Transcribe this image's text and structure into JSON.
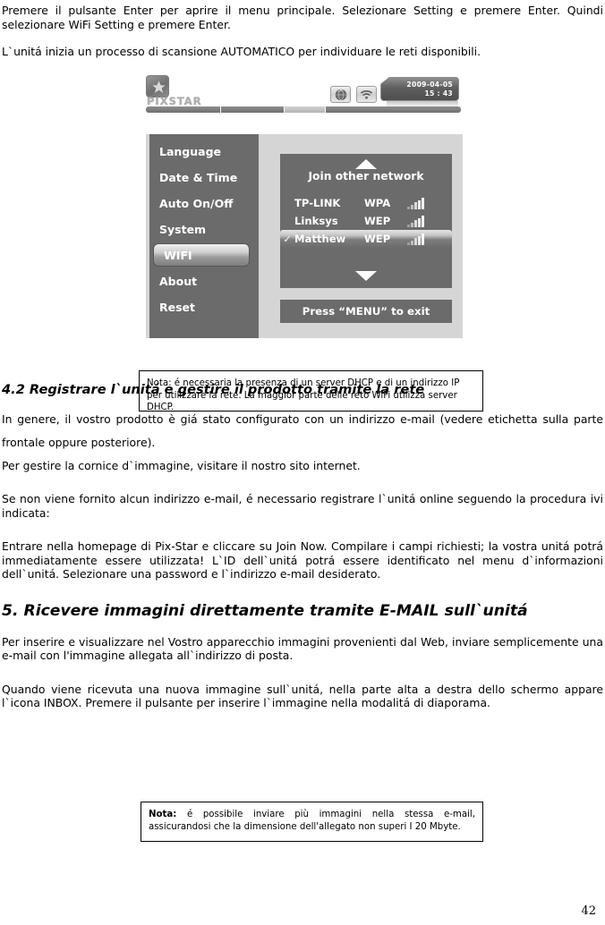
{
  "intro": {
    "p1": "Premere il pulsante Enter per aprire il menu principale. Selezionare Setting e premere Enter. Quindi selezionare WiFi Setting e premere Enter.",
    "p2": "L`unitá inizia un processo di scansione AUTOMATICO per individuare le reti disponibili."
  },
  "figure": {
    "logo_text": "PIXSTAR",
    "datetime": {
      "date": "2009-04-05",
      "time": "15 : 43"
    },
    "icons": {
      "globe": "globe-icon",
      "wifi": "wifi-icon"
    },
    "menu": {
      "items": [
        {
          "label": "Language",
          "selected": false
        },
        {
          "label": "Date & Time",
          "selected": false
        },
        {
          "label": "Auto On/Off",
          "selected": false
        },
        {
          "label": "System",
          "selected": false
        },
        {
          "label": "WIFI",
          "selected": true
        },
        {
          "label": "About",
          "selected": false
        },
        {
          "label": "Reset",
          "selected": false
        }
      ]
    },
    "network_panel": {
      "title": "Join  other network",
      "networks": [
        {
          "name": "TP-LINK",
          "security": "WPA",
          "signal": 5,
          "selected": false,
          "check": ""
        },
        {
          "name": "Linksys",
          "security": "WEP",
          "signal": 5,
          "selected": false,
          "check": ""
        },
        {
          "name": "Matthew",
          "security": "WEP",
          "signal": 5,
          "selected": true,
          "check": "✓"
        }
      ]
    },
    "exit_bar": "Press “MENU” to exit"
  },
  "note_one": "Nota: é necessaria la presenza di un server DHCP e di un indirizzo IP per utilizzare la rete. La maggior parte delle reto WiFi utilizza server DHCP.",
  "section_42": {
    "heading": "4.2 Registrare l`unitá e gestire il prodotto tramite la rete",
    "p1": "In genere, il vostro prodotto è giá stato configurato con un indirizzo e-mail (vedere etichetta sulla parte frontale oppure posteriore).",
    "p2": "Per gestire la cornice d`immagine, visitare il nostro sito internet.",
    "p3": "Se non viene fornito alcun indirizzo e-mail, é necessario registrare l`unitá online seguendo la procedura ivi indicata:",
    "p4": "Entrare nella homepage di Pix-Star e cliccare su Join Now. Compilare i campi richiesti; la vostra unitá potrá immediatamente essere utilizzata! L`ID dell`unitá potrá essere identificato nel menu d`informazioni dell`unitá. Selezionare una password e l`indirizzo e-mail desiderato."
  },
  "section_5": {
    "heading": "5. Ricevere immagini direttamente tramite E-MAIL sull`unitá",
    "p1": "Per inserire e visualizzare nel Vostro apparecchio immagini provenienti dal Web, inviare semplicemente una e-mail con l'immagine allegata all`indirizzo di posta.",
    "p2": "Quando viene ricevuta una nuova immagine sull`unitá, nella parte alta a destra dello schermo appare l`icona INBOX. Premere il pulsante per inserire l`immagine nella modalitá di diaporama."
  },
  "note_two": {
    "label": "Nota:",
    "text": " é possibile inviare più immagini nella stessa e-mail, assicurandosi che la dimensione dell'allegato non superi I 20 Mbyte."
  },
  "page_number": "42"
}
